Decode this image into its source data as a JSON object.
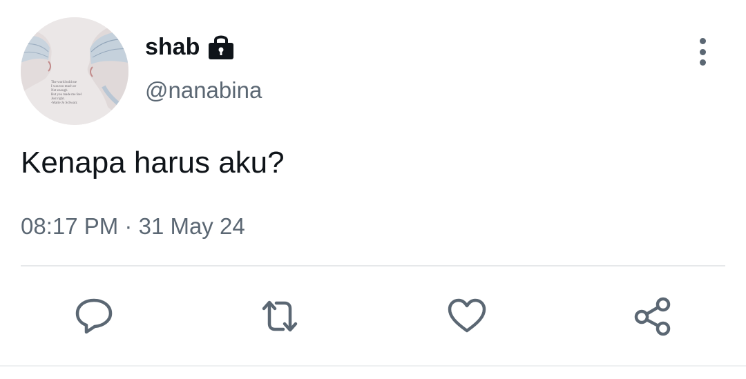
{
  "tweet": {
    "display_name": "shab",
    "handle": "@nanabina",
    "text": "Kenapa harus aku?",
    "time": "08:17 PM",
    "separator": "·",
    "date": "31 May 24"
  },
  "avatar": {
    "quote": "The world told me\nI was too much or\nNot enough\nBut you made me feel\nJust right.\n-Marie Jo Schwarz"
  },
  "icons": {
    "lock": "lock-icon",
    "more": "more-vertical-icon",
    "reply": "reply-icon",
    "retweet": "retweet-icon",
    "like": "heart-icon",
    "share": "share-icon"
  },
  "colors": {
    "text_primary": "#0f1419",
    "text_secondary": "#5b6773",
    "divider": "#e6e8ea"
  }
}
